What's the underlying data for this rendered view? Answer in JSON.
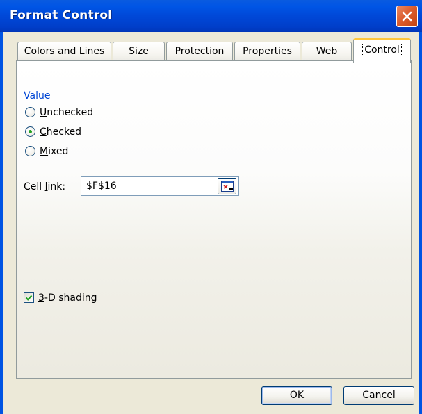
{
  "window": {
    "title": "Format Control",
    "close_icon": "close-icon"
  },
  "tabs": [
    {
      "label": "Colors and Lines",
      "active": false
    },
    {
      "label": "Size",
      "active": false
    },
    {
      "label": "Protection",
      "active": false
    },
    {
      "label": "Properties",
      "active": false
    },
    {
      "label": "Web",
      "active": false
    },
    {
      "label": "Control",
      "active": true
    }
  ],
  "value_group": {
    "label": "Value",
    "options": [
      {
        "label": "Unchecked",
        "accel": "U",
        "rest": "nchecked",
        "selected": false
      },
      {
        "label": "Checked",
        "accel": "C",
        "rest": "hecked",
        "selected": true
      },
      {
        "label": "Mixed",
        "accel": "M",
        "rest": "ixed",
        "selected": false
      }
    ]
  },
  "cell_link": {
    "label": "Cell link:",
    "label_pre": "Cell ",
    "label_accel": "l",
    "label_post": "ink:",
    "value": "$F$16",
    "button_icon": "collapse-dialog-icon"
  },
  "shading": {
    "label": "3-D shading",
    "accel": "3",
    "rest": "-D shading",
    "checked": true
  },
  "buttons": {
    "ok": "OK",
    "cancel": "Cancel"
  },
  "colors": {
    "titlebar": "#0054e3",
    "dialog_bg": "#ece9d8",
    "active_tab_accent": "#ffc73c",
    "group_label": "#0046d5",
    "radio_dot": "#21a121",
    "close_button": "#dc5d2e"
  }
}
